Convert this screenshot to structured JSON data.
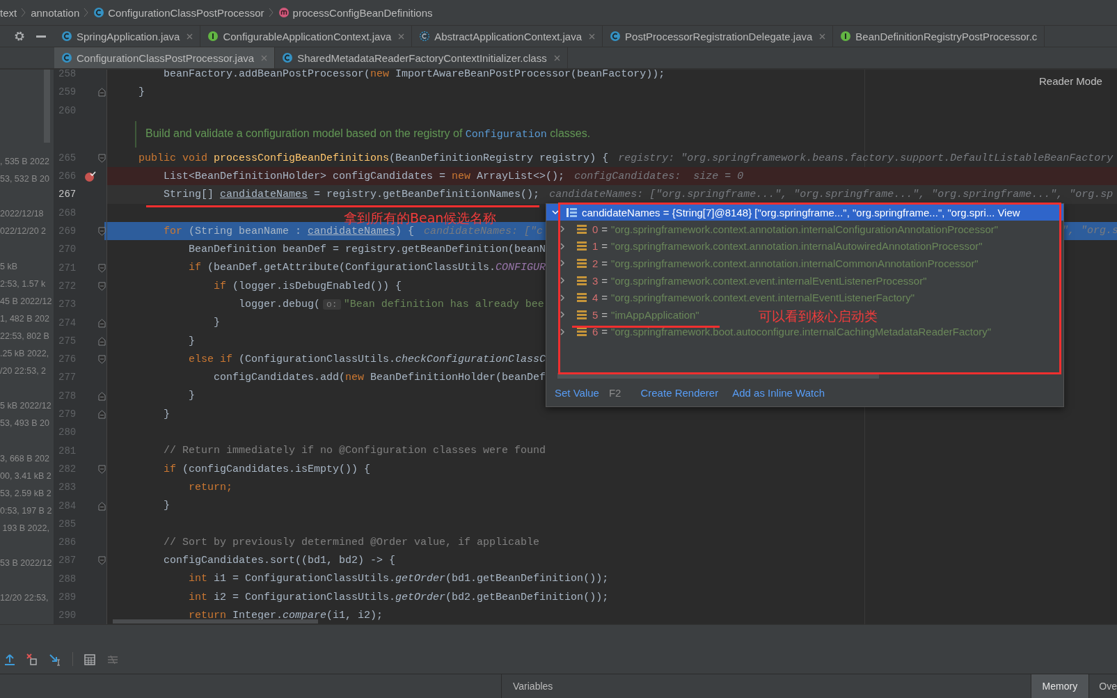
{
  "breadcrumb": [
    {
      "text": "text"
    },
    {
      "text": "annotation"
    },
    {
      "text": "ConfigurationClassPostProcessor",
      "kind": "class"
    },
    {
      "text": "processConfigBeanDefinitions",
      "kind": "method"
    }
  ],
  "tab_rows": [
    [
      {
        "label": "SpringApplication.java",
        "kind": "class",
        "selected": false,
        "closable": true
      },
      {
        "label": "ConfigurableApplicationContext.java",
        "kind": "interface",
        "selected": false,
        "closable": true
      },
      {
        "label": "AbstractApplicationContext.java",
        "kind": "abstract",
        "selected": false,
        "closable": true
      },
      {
        "label": "PostProcessorRegistrationDelegate.java",
        "kind": "class",
        "selected": false,
        "closable": true
      },
      {
        "label": "BeanDefinitionRegistryPostProcessor.c",
        "kind": "interface",
        "selected": false,
        "closable": false
      }
    ],
    [
      {
        "label": "ConfigurationClassPostProcessor.java",
        "kind": "class",
        "selected": true,
        "closable": true
      },
      {
        "label": "SharedMetadataReaderFactoryContextInitializer.class",
        "kind": "class",
        "selected": false,
        "closable": true
      }
    ]
  ],
  "file_list": [
    ", 535 B 2022",
    "53, 532 B 20",
    "2022/12/18",
    "022/12/20 2",
    "5 kB",
    "2:53, 1.57 k",
    "45 B 2022/12",
    "1, 482 B 202",
    "22:53, 802 B",
    ".25 kB 2022,",
    "/20 22:53, 2",
    "5 kB 2022/12",
    "53, 493 B 20",
    "3, 668 B 202",
    "00, 3.41 kB 2",
    "53, 2.59 kB 2",
    "0:53, 197 B 2",
    " 193 B 2022,",
    "53 B 2022/12",
    "12/20 22:53,"
  ],
  "reader_mode": "Reader Mode",
  "editor": {
    "lines": [
      {
        "kind": "code",
        "number": "258",
        "breakpoint": false,
        "caret_line": false,
        "execution_point": false,
        "fold_start": false,
        "fold_end": false,
        "tokens": [
          {
            "kind": "plain",
            "text": "    beanFactory.addBeanPostProcessor("
          },
          {
            "kind": "kw",
            "text": "new"
          },
          {
            "kind": "plain",
            "text": " ImportAwareBeanPostProcessor(beanFactory));"
          }
        ]
      },
      {
        "kind": "code",
        "number": "259",
        "breakpoint": false,
        "caret_line": false,
        "execution_point": false,
        "fold_start": false,
        "fold_end": true,
        "tokens": [
          {
            "kind": "plain",
            "text": "}"
          }
        ]
      },
      {
        "kind": "code",
        "number": "260",
        "breakpoint": false,
        "caret_line": false,
        "execution_point": false,
        "fold_start": false,
        "fold_end": false
      },
      {
        "kind": "doc",
        "tokens": [
          {
            "kind": "doc",
            "text": "Build and validate a configuration model based on the registry of "
          },
          {
            "kind": "doc_code",
            "text": "Configuration"
          },
          {
            "kind": "doc",
            "text": " classes."
          }
        ]
      },
      {
        "kind": "code",
        "number": "265",
        "breakpoint": false,
        "caret_line": false,
        "execution_point": false,
        "fold_start": true,
        "fold_end": false,
        "tokens": [
          {
            "kind": "kw",
            "text": "public void "
          },
          {
            "kind": "decl",
            "text": "processConfigBeanDefinitions"
          },
          {
            "kind": "plain",
            "text": "(BeanDefinitionRegistry registry) {"
          }
        ],
        "hint": "registry: \"org.springframework.beans.factory.support.DefaultListableBeanFactory"
      },
      {
        "kind": "code",
        "number": "266",
        "breakpoint": true,
        "caret_line": false,
        "execution_point": false,
        "fold_start": false,
        "fold_end": false,
        "tokens": [
          {
            "kind": "plain",
            "text": "    List<BeanDefinitionHolder> configCandidates = "
          },
          {
            "kind": "kw",
            "text": "new"
          },
          {
            "kind": "plain",
            "text": " ArrayList<>();"
          }
        ],
        "hint": "configCandidates:  size = 0"
      },
      {
        "kind": "code",
        "number": "267",
        "breakpoint": false,
        "caret_line": true,
        "execution_point": false,
        "fold_start": false,
        "fold_end": false,
        "tokens": [
          {
            "kind": "plain",
            "text": "    String[] "
          },
          {
            "kind": "ref",
            "text": "candidateNames"
          },
          {
            "kind": "plain",
            "text": " = registry.getBeanDefinitionNames();"
          }
        ],
        "hint": "candidateNames: [\"org.springframe...\", \"org.springframe...\", \"org.springframe...\", \"org.sp"
      },
      {
        "kind": "code",
        "number": "268",
        "breakpoint": false,
        "caret_line": false,
        "execution_point": false,
        "fold_start": false,
        "fold_end": false
      },
      {
        "kind": "code",
        "number": "269",
        "breakpoint": false,
        "caret_line": false,
        "execution_point": true,
        "fold_start": true,
        "fold_end": false,
        "tokens": [
          {
            "kind": "kw",
            "text": "    for"
          },
          {
            "kind": "plain",
            "text": " (String beanName : "
          },
          {
            "kind": "ref",
            "text": "candidateNames"
          },
          {
            "kind": "plain",
            "text": ") {"
          }
        ],
        "hint": "candidateNames: [\"c",
        "tail": "\", \"org.s"
      },
      {
        "kind": "code",
        "number": "270",
        "breakpoint": false,
        "caret_line": false,
        "execution_point": false,
        "fold_start": false,
        "fold_end": false,
        "tokens": [
          {
            "kind": "plain",
            "text": "        BeanDefinition beanDef = registry.getBeanDefinition(beanN"
          }
        ]
      },
      {
        "kind": "code",
        "number": "271",
        "breakpoint": false,
        "caret_line": false,
        "execution_point": false,
        "fold_start": true,
        "fold_end": false,
        "tokens": [
          {
            "kind": "kw",
            "text": "        if"
          },
          {
            "kind": "plain",
            "text": " (beanDef.getAttribute(ConfigurationClassUtils."
          },
          {
            "kind": "const",
            "text": "CONFIGUR"
          }
        ]
      },
      {
        "kind": "code",
        "number": "272",
        "breakpoint": false,
        "caret_line": false,
        "execution_point": false,
        "fold_start": true,
        "fold_end": false,
        "tokens": [
          {
            "kind": "kw",
            "text": "            if"
          },
          {
            "kind": "plain",
            "text": " (logger.isDebugEnabled()) {"
          }
        ]
      },
      {
        "kind": "code",
        "number": "273",
        "breakpoint": false,
        "caret_line": false,
        "execution_point": false,
        "fold_start": false,
        "fold_end": false,
        "tokens": [
          {
            "kind": "plain",
            "text": "                logger.debug("
          },
          {
            "kind": "param",
            "text": "o:"
          },
          {
            "kind": "str",
            "text": "\"Bean definition has already bee"
          }
        ]
      },
      {
        "kind": "code",
        "number": "274",
        "breakpoint": false,
        "caret_line": false,
        "execution_point": false,
        "fold_start": false,
        "fold_end": true,
        "tokens": [
          {
            "kind": "plain",
            "text": "            }"
          }
        ]
      },
      {
        "kind": "code",
        "number": "275",
        "breakpoint": false,
        "caret_line": false,
        "execution_point": false,
        "fold_start": false,
        "fold_end": true,
        "tokens": [
          {
            "kind": "plain",
            "text": "        }"
          }
        ]
      },
      {
        "kind": "code",
        "number": "276",
        "breakpoint": false,
        "caret_line": false,
        "execution_point": false,
        "fold_start": true,
        "fold_end": false,
        "tokens": [
          {
            "kind": "kw",
            "text": "        else if"
          },
          {
            "kind": "plain",
            "text": " (ConfigurationClassUtils."
          },
          {
            "kind": "static",
            "text": "checkConfigurationClassC"
          }
        ]
      },
      {
        "kind": "code",
        "number": "277",
        "breakpoint": false,
        "caret_line": false,
        "execution_point": false,
        "fold_start": false,
        "fold_end": false,
        "tokens": [
          {
            "kind": "plain",
            "text": "            configCandidates.add("
          },
          {
            "kind": "kw",
            "text": "new"
          },
          {
            "kind": "plain",
            "text": " BeanDefinitionHolder(beanDef"
          }
        ]
      },
      {
        "kind": "code",
        "number": "278",
        "breakpoint": false,
        "caret_line": false,
        "execution_point": false,
        "fold_start": false,
        "fold_end": true,
        "tokens": [
          {
            "kind": "plain",
            "text": "        }"
          }
        ]
      },
      {
        "kind": "code",
        "number": "279",
        "breakpoint": false,
        "caret_line": false,
        "execution_point": false,
        "fold_start": false,
        "fold_end": true,
        "tokens": [
          {
            "kind": "plain",
            "text": "    }"
          }
        ]
      },
      {
        "kind": "code",
        "number": "280",
        "breakpoint": false,
        "caret_line": false,
        "execution_point": false,
        "fold_start": false,
        "fold_end": false
      },
      {
        "kind": "code",
        "number": "281",
        "breakpoint": false,
        "caret_line": false,
        "execution_point": false,
        "fold_start": false,
        "fold_end": false,
        "tokens": [
          {
            "kind": "comment",
            "text": "    // Return immediately if no @Configuration classes were found"
          }
        ]
      },
      {
        "kind": "code",
        "number": "282",
        "breakpoint": false,
        "caret_line": false,
        "execution_point": false,
        "fold_start": true,
        "fold_end": false,
        "tokens": [
          {
            "kind": "kw",
            "text": "    if"
          },
          {
            "kind": "plain",
            "text": " (configCandidates.isEmpty()) {"
          }
        ]
      },
      {
        "kind": "code",
        "number": "283",
        "breakpoint": false,
        "caret_line": false,
        "execution_point": false,
        "fold_start": false,
        "fold_end": false,
        "tokens": [
          {
            "kind": "kw",
            "text": "        return;"
          }
        ]
      },
      {
        "kind": "code",
        "number": "284",
        "breakpoint": false,
        "caret_line": false,
        "execution_point": false,
        "fold_start": false,
        "fold_end": true,
        "tokens": [
          {
            "kind": "plain",
            "text": "    }"
          }
        ]
      },
      {
        "kind": "code",
        "number": "285",
        "breakpoint": false,
        "caret_line": false,
        "execution_point": false,
        "fold_start": false,
        "fold_end": false
      },
      {
        "kind": "code",
        "number": "286",
        "breakpoint": false,
        "caret_line": false,
        "execution_point": false,
        "fold_start": false,
        "fold_end": false,
        "tokens": [
          {
            "kind": "comment",
            "text": "    // Sort by previously determined @Order value, if applicable"
          }
        ]
      },
      {
        "kind": "code",
        "number": "287",
        "breakpoint": false,
        "caret_line": false,
        "execution_point": false,
        "fold_start": true,
        "fold_end": false,
        "tokens": [
          {
            "kind": "plain",
            "text": "    configCandidates.sort((bd1, bd2) -> {"
          }
        ]
      },
      {
        "kind": "code",
        "number": "288",
        "breakpoint": false,
        "caret_line": false,
        "execution_point": false,
        "fold_start": false,
        "fold_end": false,
        "tokens": [
          {
            "kind": "kw",
            "text": "        int"
          },
          {
            "kind": "plain",
            "text": " i1 = ConfigurationClassUtils."
          },
          {
            "kind": "static",
            "text": "getOrder"
          },
          {
            "kind": "plain",
            "text": "(bd1.getBeanDefinition());"
          }
        ]
      },
      {
        "kind": "code",
        "number": "289",
        "breakpoint": false,
        "caret_line": false,
        "execution_point": false,
        "fold_start": false,
        "fold_end": false,
        "tokens": [
          {
            "kind": "kw",
            "text": "        int"
          },
          {
            "kind": "plain",
            "text": " i2 = ConfigurationClassUtils."
          },
          {
            "kind": "static",
            "text": "getOrder"
          },
          {
            "kind": "plain",
            "text": "(bd2.getBeanDefinition());"
          }
        ]
      },
      {
        "kind": "code",
        "number": "290",
        "breakpoint": false,
        "caret_line": false,
        "execution_point": false,
        "fold_start": false,
        "fold_end": false,
        "tokens": [
          {
            "kind": "kw",
            "text": "        return"
          },
          {
            "kind": "plain",
            "text": " Integer."
          },
          {
            "kind": "static",
            "text": "compare"
          },
          {
            "kind": "plain",
            "text": "(i1, i2);"
          }
        ]
      }
    ]
  },
  "popup": {
    "header": {
      "text": "candidateNames = {String[7]@8148} [\"org.springframe...\", \"org.springframe...\", \"org.spri...",
      "link": "View",
      "expanded": true
    },
    "entries": [
      {
        "index": "0",
        "operator": "=",
        "value": "\"org.springframework.context.annotation.internalConfigurationAnnotationProcessor\"",
        "expanded": false
      },
      {
        "index": "1",
        "operator": "=",
        "value": "\"org.springframework.context.annotation.internalAutowiredAnnotationProcessor\"",
        "expanded": false
      },
      {
        "index": "2",
        "operator": "=",
        "value": "\"org.springframework.context.annotation.internalCommonAnnotationProcessor\"",
        "expanded": false
      },
      {
        "index": "3",
        "operator": "=",
        "value": "\"org.springframework.context.event.internalEventListenerProcessor\"",
        "expanded": false
      },
      {
        "index": "4",
        "operator": "=",
        "value": "\"org.springframework.context.event.internalEventListenerFactory\"",
        "expanded": false
      },
      {
        "index": "5",
        "operator": "=",
        "value": "\"imAppApplication\"",
        "expanded": false
      },
      {
        "index": "6",
        "operator": "=",
        "value": "\"org.springframework.boot.autoconfigure.internalCachingMetadataReaderFactory\"",
        "expanded": false
      }
    ],
    "actions": [
      {
        "label": "Set Value",
        "shortcut": "F2"
      },
      {
        "label": "Create Renderer"
      },
      {
        "label": "Add as Inline Watch"
      }
    ]
  },
  "annotations": [
    {
      "text": "拿到所有的Bean候选名称"
    },
    {
      "text": "可以看到核心启动类"
    }
  ],
  "bottom_tabs": [
    {
      "label": "Variables",
      "selected": false
    },
    {
      "label": "Memory",
      "selected": true
    },
    {
      "label": "Ove",
      "selected": false
    }
  ]
}
